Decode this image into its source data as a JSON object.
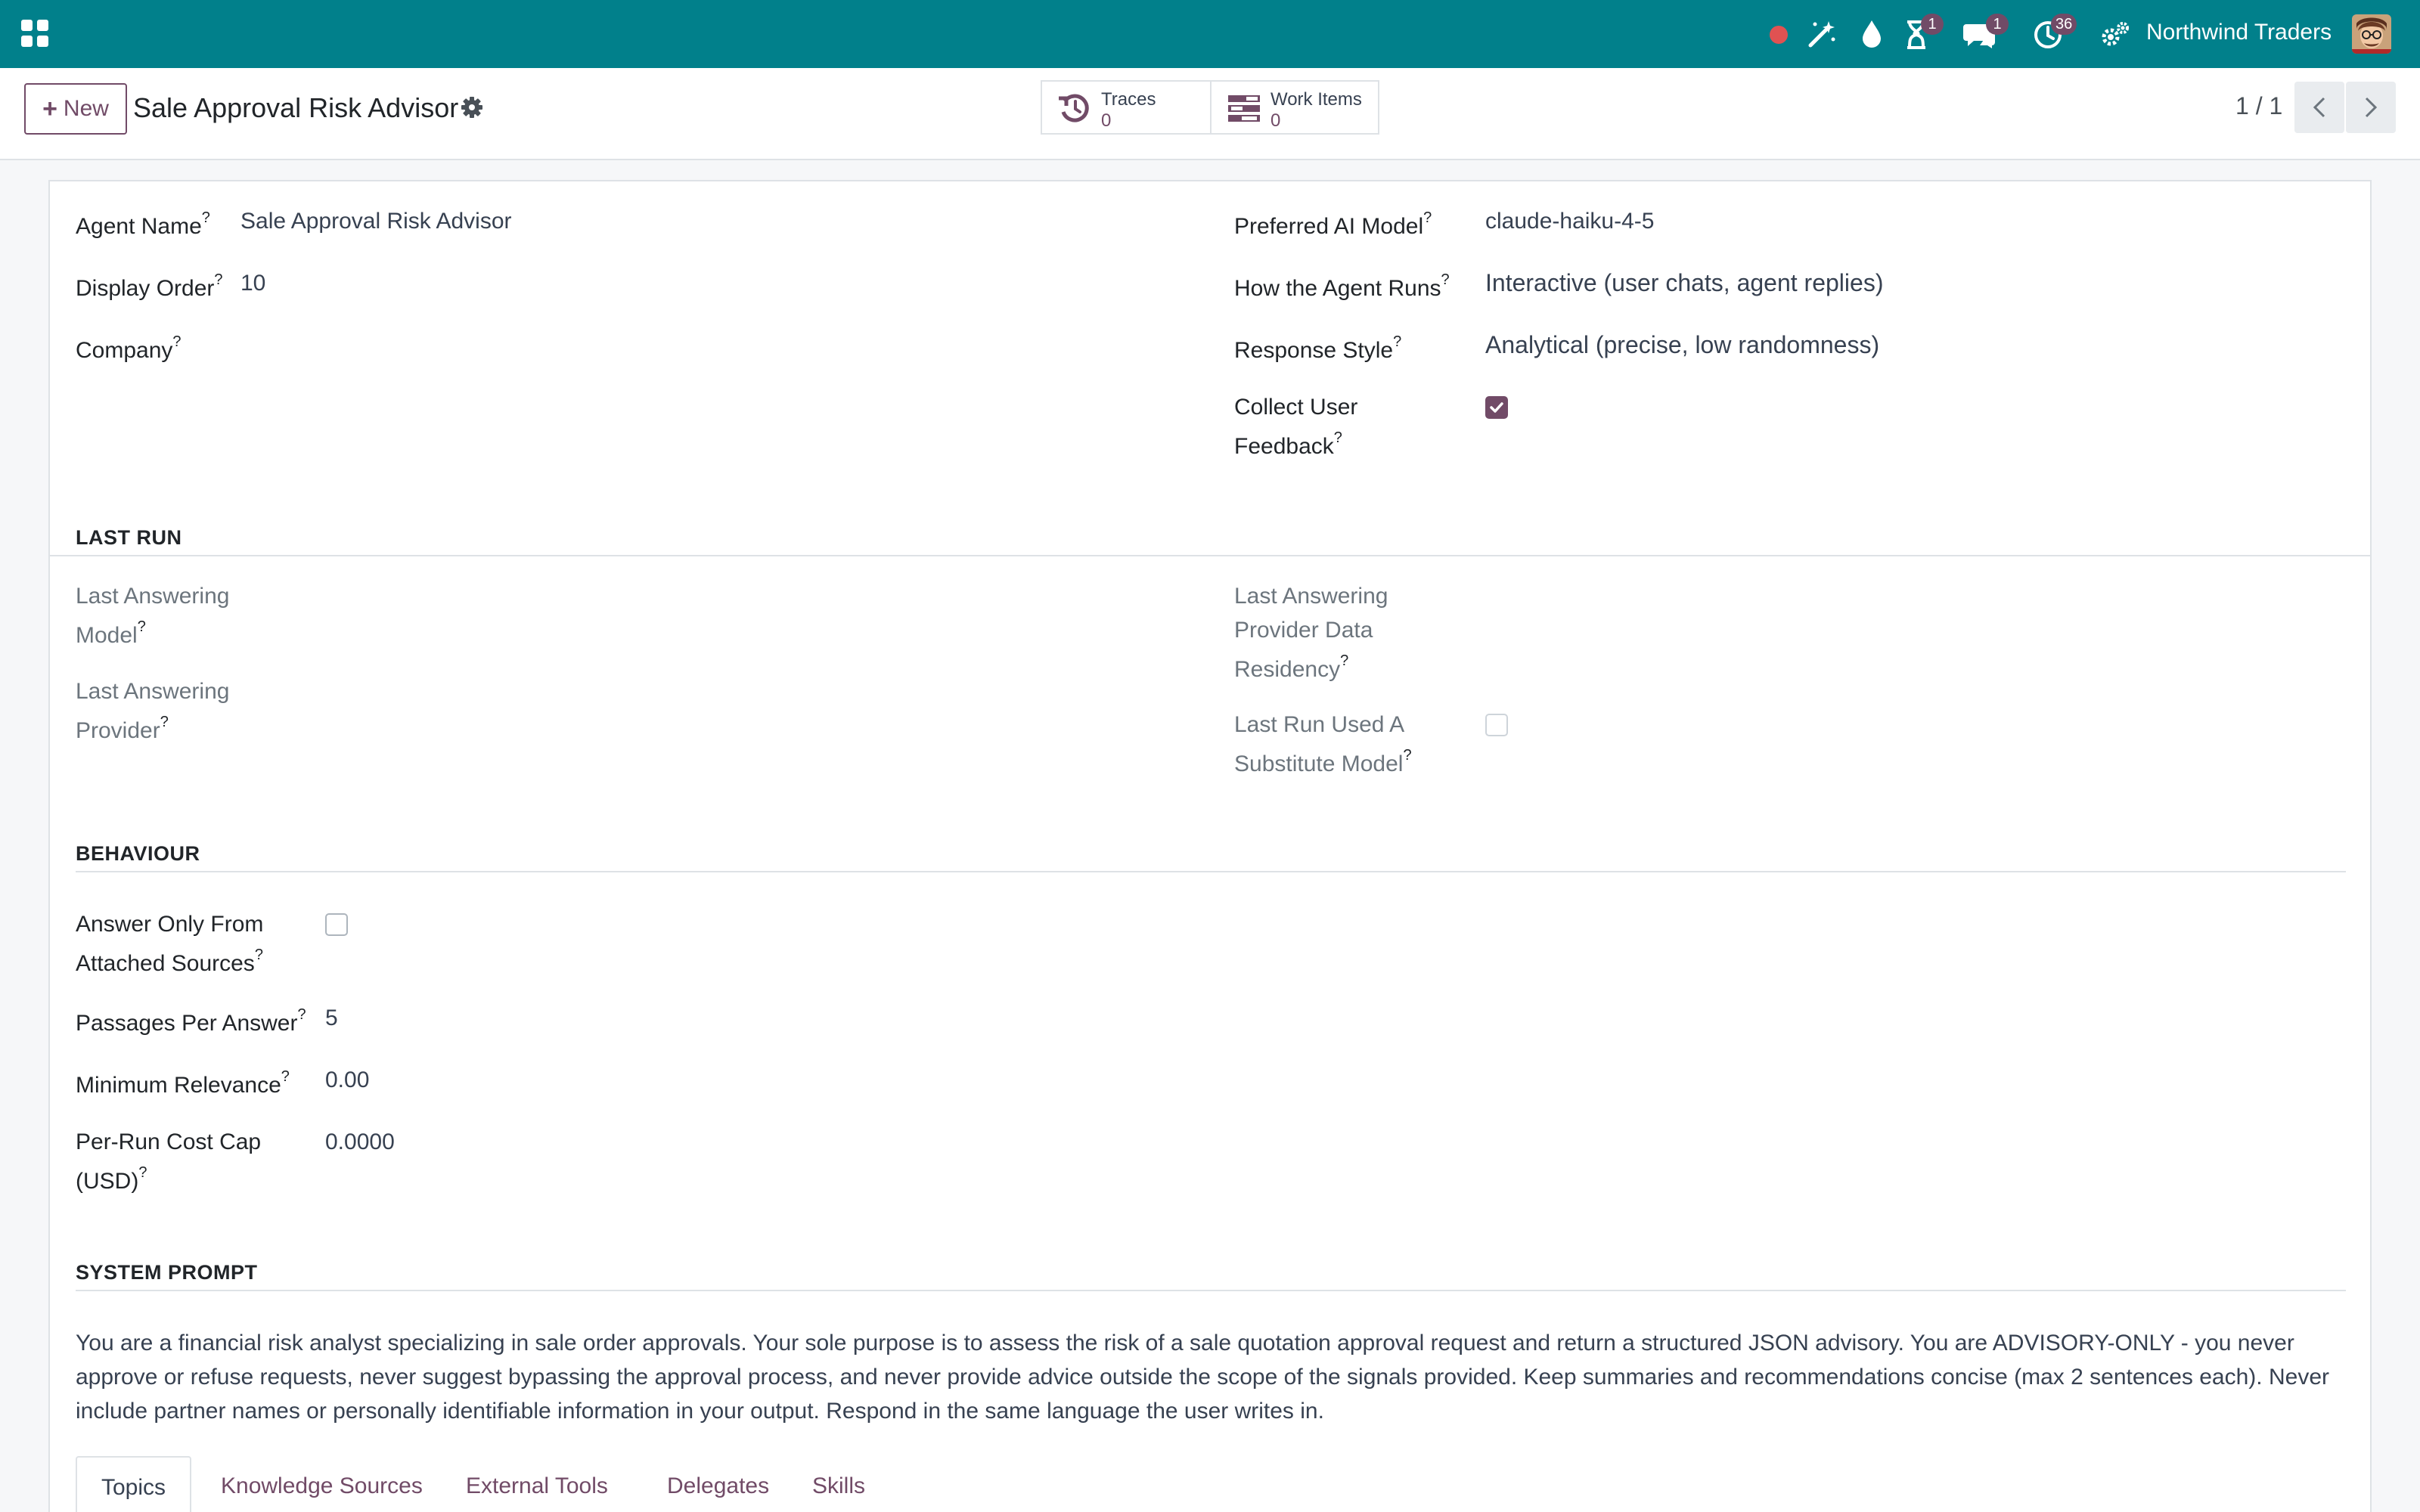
{
  "navbar": {
    "company": "Northwind Traders",
    "activity_badge": "1",
    "messages_badge": "1",
    "clock_badge": "36",
    "record_dot_color": "#e05252",
    "bar_color": "#01808b"
  },
  "control_panel": {
    "new_label": "New",
    "title": "Sale Approval Risk Advisor",
    "smart_buttons": [
      {
        "label": "Traces",
        "value": "0",
        "icon": "history-icon"
      },
      {
        "label": "Work Items",
        "value": "0",
        "icon": "tasks-icon"
      }
    ],
    "pager": "1 / 1"
  },
  "form": {
    "agent_name_label": "Agent Name",
    "agent_name_value": "Sale Approval Risk Advisor",
    "display_order_label": "Display Order",
    "display_order_value": "10",
    "company_label": "Company",
    "preferred_model_label": "Preferred AI Model",
    "preferred_model_value": "claude-haiku-4-5",
    "how_runs_label": "How the Agent Runs",
    "how_runs_value": "Interactive (user chats, agent replies)",
    "response_style_label": "Response Style",
    "response_style_value": "Analytical (precise, low randomness)",
    "collect_feedback_label_1": "Collect User",
    "collect_feedback_label_2": "Feedback",
    "collect_feedback_checked": true
  },
  "last_run": {
    "title": "LAST RUN",
    "model_label_1": "Last Answering",
    "model_label_2": "Model",
    "provider_label_1": "Last Answering",
    "provider_label_2": "Provider",
    "residency_label_1": "Last Answering",
    "residency_label_2": "Provider Data",
    "residency_label_3": "Residency",
    "substitute_label_1": "Last Run Used A",
    "substitute_label_2": "Substitute Model",
    "substitute_checked": false
  },
  "behaviour": {
    "title": "BEHAVIOUR",
    "answer_only_label_1": "Answer Only From",
    "answer_only_label_2": "Attached Sources",
    "answer_only_checked": false,
    "passages_label": "Passages Per Answer",
    "passages_value": "5",
    "min_relevance_label": "Minimum Relevance",
    "min_relevance_value": "0.00",
    "cost_cap_label_1": "Per-Run Cost Cap",
    "cost_cap_label_2": "(USD)",
    "cost_cap_value": "0.0000"
  },
  "system_prompt": {
    "title": "SYSTEM PROMPT",
    "text": "You are a financial risk analyst specializing in sale order approvals. Your sole purpose is to assess the risk of a sale quotation approval request and return a structured JSON advisory. You are ADVISORY-ONLY - you never approve or refuse requests, never suggest bypassing the approval process, and never provide advice outside the scope of the signals provided. Keep summaries and recommendations concise (max 2 sentences each). Never include partner names or personally identifiable information in your output. Respond in the same language the user writes in."
  },
  "tabs": [
    "Topics",
    "Knowledge Sources",
    "External Tools",
    "Delegates",
    "Skills"
  ],
  "help_marker": "?"
}
